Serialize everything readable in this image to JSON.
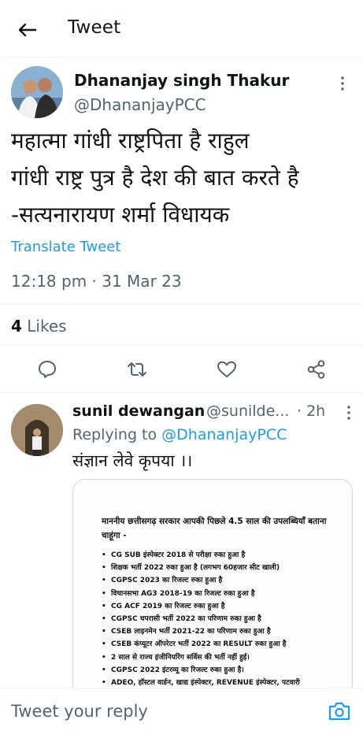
{
  "header": {
    "title": "Tweet"
  },
  "tweet": {
    "display_name": "Dhananjay singh Thakur",
    "handle": "@DhananjayPCC",
    "text": "महात्मा गांधी राष्ट्रपिता है राहुल\nगांधी राष्ट्र पुत्र है देश की बात करते है\n-सत्यनारायण शर्मा  विधायक",
    "translate_label": "Translate Tweet",
    "timestamp": "12:18 pm · 31 Mar 23",
    "likes_count": "4",
    "likes_label": "Likes"
  },
  "actions": [
    {
      "icon": "reply-icon"
    },
    {
      "icon": "retweet-icon"
    },
    {
      "icon": "like-icon"
    },
    {
      "icon": "share-icon"
    }
  ],
  "reply": {
    "display_name": "sunil dewangan",
    "handle": "@sunilde...",
    "time": "· 2h",
    "replying_prefix": "Replying to",
    "replying_to": "@DhananjayPCC",
    "text": "संज्ञान लेवे कृपया ।।",
    "attachment": {
      "heading": "माननीय छत्तीसगढ़ सरकार आपकी पिछले 4.5 साल की उपलब्धियाँ बताना चाहूंगा -",
      "items": [
        "CG SUB इंस्पेक्टर 2018 से परीक्षा रुका हुआ है",
        "शिक्षक भर्ती 2022 रुका हुआ है (लगभग 60हजार सीट खाली)",
        "CGPSC 2023 का रिजल्ट रुका हुआ है",
        "विधानसभा AG3 2018-19 का रिजल्ट रुका हुआ है",
        "CG ACF 2019 का रिजल्ट रुका हुआ है",
        "CGPSC चपरासी भर्ती 2022 का परिणाम रुका हुआ है",
        "CSEB लाइनमेन भर्ती 2021-22 का परिणाम रुका हुआ है",
        "CSEB कंप्यूटर ऑपरेटर भर्ती 2022 का RESULT रुका हुआ है",
        "2 साल से राज्य इंजीनियरिंग सर्विस की भर्ती नहीं हुई।",
        "CGPSC 2022 इंटरव्यू का रिजल्ट रुका हुआ है।",
        "ADEO, हॉस्टल वार्डन, खाद्य इंस्पेक्टर, REVENUE इंस्पेक्टर, पटवारी"
      ]
    }
  },
  "composer": {
    "placeholder": "Tweet your reply"
  },
  "colors": {
    "link": "#1d9bf0",
    "muted": "#536471",
    "text": "#0f1419"
  }
}
